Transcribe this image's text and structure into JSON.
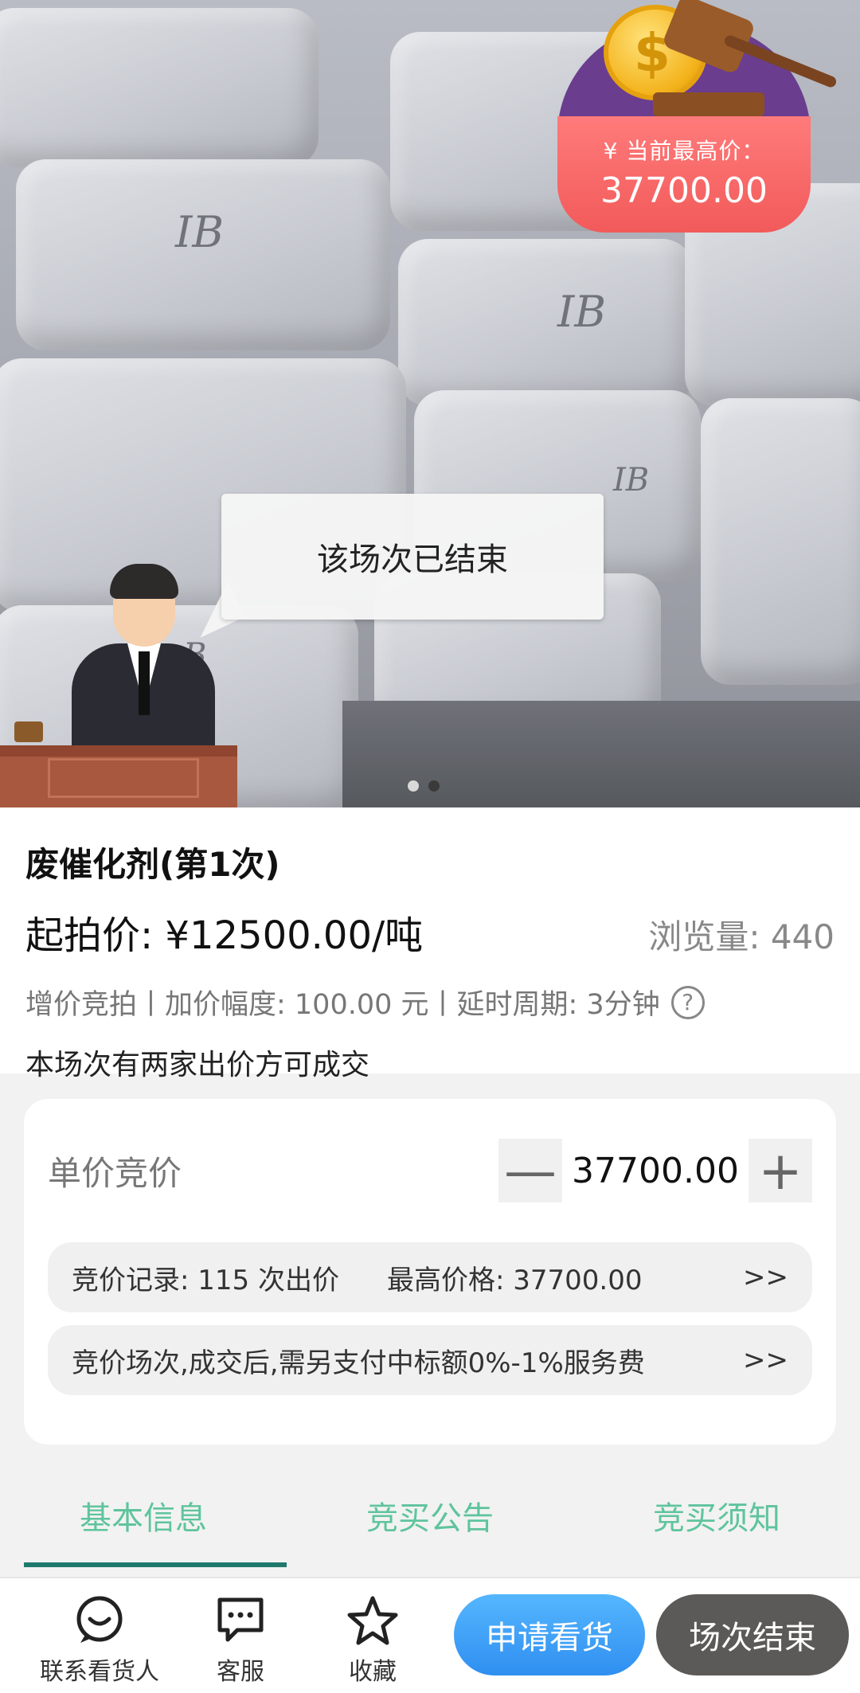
{
  "hero": {
    "current_price_label": "¥ 当前最高价：",
    "current_price_value": "37700.00",
    "status_text": "该场次已结束",
    "bag_tags": [
      "IB",
      "IB",
      "IB",
      "B"
    ],
    "carousel": {
      "count": 2,
      "active_index": 1
    }
  },
  "product": {
    "title": "废催化剂(第1次)",
    "start_price": "起拍价: ¥12500.00/吨",
    "views": "浏览量: 440",
    "rules": "增价竞拍丨加价幅度:  100.00 元丨延时周期:  3分钟",
    "help_glyph": "?",
    "note": "本场次有两家出价方可成交"
  },
  "bid": {
    "label": "单价竞价",
    "minus_glyph": "—",
    "plus_glyph": "+",
    "value": "37700.00",
    "record_text": "竞价记录: 115 次出价",
    "max_price_text": "最高价格: 37700.00",
    "fee_text": "竞价场次,成交后,需另支付中标额0%-1%服务费",
    "arrow": ">>"
  },
  "tabs": [
    {
      "label": "基本信息",
      "active": true
    },
    {
      "label": "竞买公告",
      "active": false
    },
    {
      "label": "竞买须知",
      "active": false
    }
  ],
  "bottom_bar": {
    "contact_label": "联系看货人",
    "service_label": "客服",
    "favorite_label": "收藏",
    "apply_label": "申请看货",
    "ended_label": "场次结束",
    "icons": [
      "contact-icon",
      "chat-icon",
      "star-icon"
    ]
  },
  "colors": {
    "accent_green": "#5fc49d",
    "tab_underline": "#1f7a6e",
    "apply_blue": "#2f8ff0",
    "price_badge_red": "#f25a5a",
    "ended_gray": "#5c5a58"
  }
}
